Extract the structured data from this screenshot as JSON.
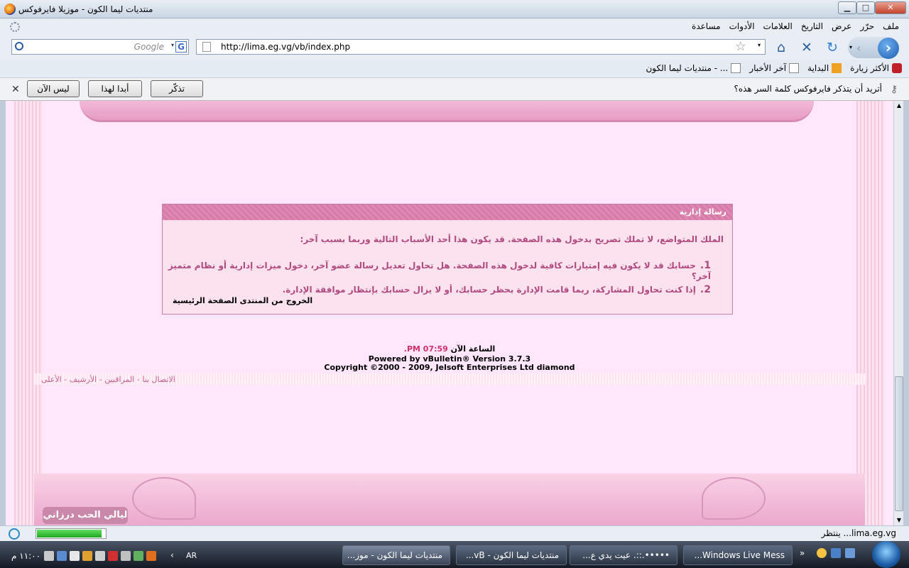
{
  "window": {
    "title": "منتديات ليما الكون - موزيلا فايرفوكس",
    "minimize": "▁",
    "maximize": "□",
    "close": "✕"
  },
  "menu": [
    "ملف",
    "حرّر",
    "عرض",
    "التاريخ",
    "العلامات",
    "الأدوات",
    "مساعدة"
  ],
  "search": {
    "placeholder": "Google",
    "engine_letter": "G"
  },
  "url": "http://lima.eg.vg/vb/index.php",
  "bookmarks": [
    {
      "label": "الأكثر زيارة",
      "icon": "most-visited-icon",
      "color": "#c0202a"
    },
    {
      "label": "البداية",
      "icon": "rss-icon",
      "color": "#f0a020"
    },
    {
      "label": "آخر الأخبار",
      "icon": "page-icon",
      "color": "#ffffff"
    },
    {
      "label": "منتديات ليما الكون - ...",
      "icon": "forum-icon",
      "color": "#ffffff"
    }
  ],
  "password_bar": {
    "question": "أتريد أن يتذكر فايرفوكس كلمة السر هذه؟",
    "remember": "تذكّر",
    "never": "أبدا لهذا الموقع",
    "not_now": "ليس الآن"
  },
  "message": {
    "header": "رسالة إدارية",
    "lead": "الملك المتواضع، لا تملك تصريح بدخول هذه الصفحة. قد يكون هذا أحد الأسباب التالية وربما بسبب آخر:",
    "reasons": [
      {
        "num": "1.",
        "text": "حسابك قد لا يكون فيه إمتيازات كافية لدخول هذه الصفحة. هل تحاول تعديل رسالة عضو آخر، دخول ميزات إدارية أو نظام متميز آخر؟"
      },
      {
        "num": "2.",
        "text": "إذا كنت تحاول المشاركة، ربما قامت الإدارة بحظر حسابك، أو لا يزال حسابك بإنتظار موافقة الإدارة."
      }
    ],
    "logout": "الخروج من المنتدى الصفحة الرئيسية"
  },
  "footer": {
    "time_label": "الساعة الآن",
    "time_value": "07:59 PM.",
    "powered": "Powered by vBulletin® Version 3.7.3",
    "copyright": "Copyright ©2000 - 2009, Jelsoft Enterprises Ltd diamond",
    "links": "الاتصال بنا - المراقبين - الأرشيف - الأعلى",
    "logo_text": "ليالي الحب درزاني"
  },
  "status": {
    "text": "lima.eg.vg... ينتظر",
    "progress": 0.95
  },
  "taskbar": {
    "tasks": [
      "منتديات ليما الكون - موز...",
      "منتديات ليما الكون - vB...",
      "•••••.::. عيت يدي ع...",
      "Windows Live Mess..."
    ],
    "clock": "١١:٠٠ م",
    "language": "AR"
  },
  "colors": {
    "accent": "#d0306a",
    "message_text": "#b04a80",
    "page_bg": "#ffe6fa"
  }
}
